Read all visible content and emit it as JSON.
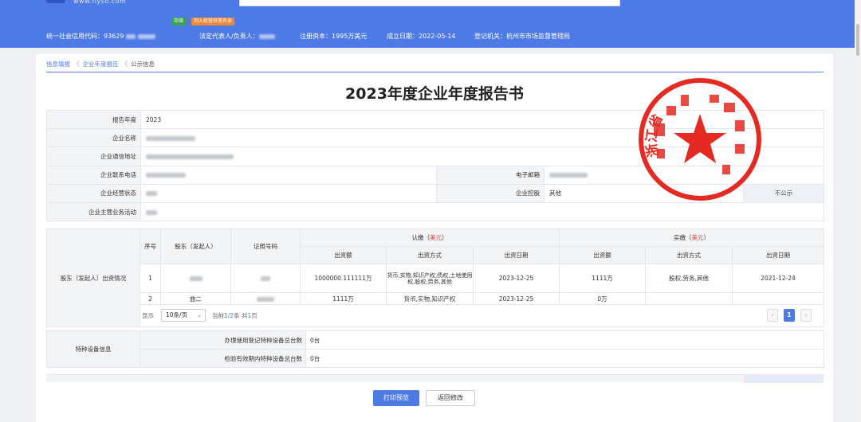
{
  "header": {
    "tags": [
      "存续",
      "列入经营异常名录"
    ],
    "credit_code_label": "统一社会信用代码：",
    "credit_code_value": "93629",
    "legal_rep_label": "法定代表人/负责人：",
    "capital_label": "注册资本：",
    "capital_value": "1995万美元",
    "established_label": "成立日期：",
    "established_value": "2022-05-14",
    "authority_label": "登记机关：",
    "authority_value": "杭州市市场监督管理局"
  },
  "breadcrumb": [
    "信息填报",
    "企业年度报告",
    "公示信息"
  ],
  "title": "2023年度企业年度报告书",
  "basic_info": {
    "year_label": "报告年度",
    "year_value": "2023",
    "name_label": "企业名称",
    "address_label": "企业通信地址",
    "phone_label": "企业联系电话",
    "email_label": "电子邮箱",
    "status_label": "企业经营状态",
    "holding_label": "企业控股",
    "holding_value": "其他",
    "not_public": "不公示",
    "business_label": "企业主营业务活动"
  },
  "shareholders": {
    "section_label": "股东（发起人）出资情况",
    "col_no": "序号",
    "col_holder": "股东（发起人）",
    "col_cert": "证照号码",
    "subscribed_prefix": "认缴（",
    "actual_prefix": "实缴（",
    "currency": "美元",
    "suffix": "）",
    "col_amount": "出资额",
    "col_method": "出资方式",
    "col_date": "出资日期",
    "rows": [
      {
        "no": "1",
        "sub_amount": "1000000.111111万",
        "sub_method": "货币,实物,知识产权,债权,土地使用权,股权,劳务,其他",
        "sub_date": "2023-12-25",
        "act_amount": "1111万",
        "act_method": "股权,劳务,其他",
        "act_date": "2021-12-24"
      },
      {
        "no": "2",
        "holder": "曲二",
        "sub_amount": "1111万",
        "sub_method": "货币,实物,知识产权",
        "sub_date": "2023-12-25",
        "act_amount": "0万",
        "act_method": "",
        "act_date": ""
      }
    ],
    "pager": {
      "show": "显示",
      "page_size": "10条/页",
      "info_prefix": "当前",
      "info_range": "1/2",
      "info_mid": "条 共",
      "info_total": "1",
      "info_suffix": "页",
      "current_page": "1"
    }
  },
  "special_equipment": {
    "section_label": "特种设备信息",
    "row1_label": "办理使用登记特种设备总台数",
    "row1_value": "0台",
    "row2_label": "检验有效期内特种设备总台数",
    "row2_value": "0台"
  },
  "buttons": {
    "print": "打印预览",
    "back": "返回修改"
  },
  "seal": {
    "text": "浙江省",
    "color": "#e42a22"
  },
  "colors": {
    "primary": "#4e7ae6",
    "tag_green": "#3aa44f",
    "tag_orange": "#f0883a"
  }
}
